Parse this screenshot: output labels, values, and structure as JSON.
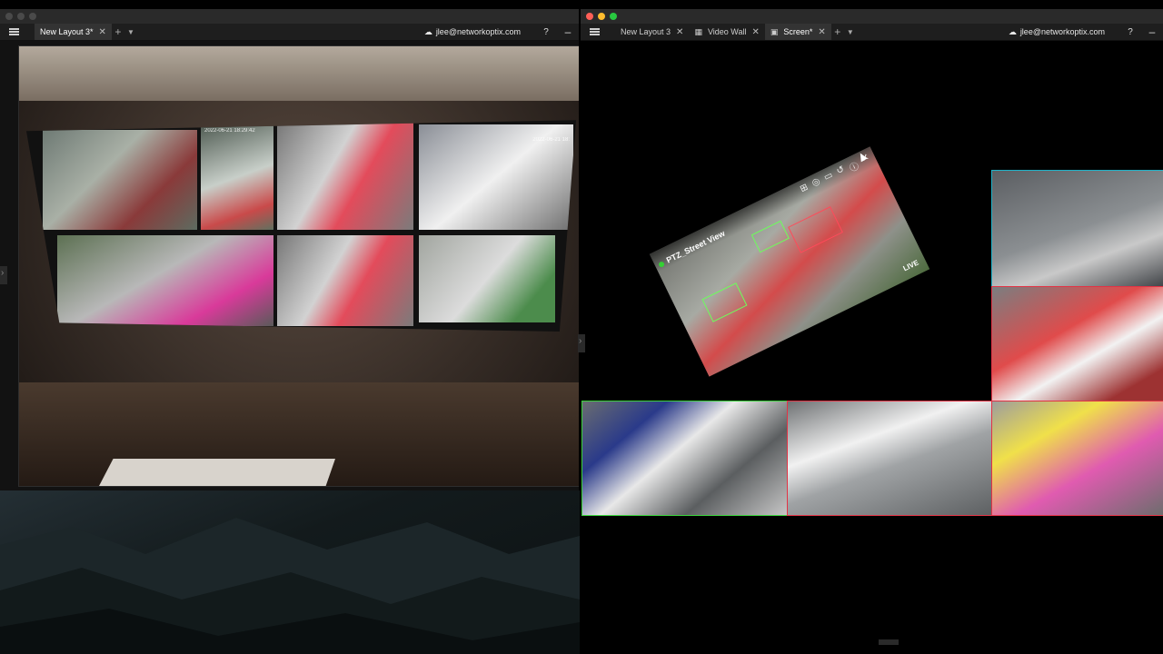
{
  "left_window": {
    "tabs": [
      {
        "label": "New Layout 3*",
        "active": true
      }
    ],
    "account": "jlee@networkoptix.com",
    "help_label": "?",
    "minimize_label": "–",
    "plus_label": "+",
    "timestamp_a": "2022-06-21 18:29:42",
    "timestamp_b": "2022-06-21 18:"
  },
  "right_window": {
    "tabs": [
      {
        "label": "New Layout 3",
        "active": false,
        "icon": ""
      },
      {
        "label": "Video Wall",
        "active": false,
        "icon": "video-wall-icon"
      },
      {
        "label": "Screen*",
        "active": true,
        "icon": "screen-icon"
      }
    ],
    "account": "jlee@networkoptix.com",
    "help_label": "?",
    "minimize_label": "–",
    "plus_label": "+",
    "ptz_camera": {
      "title": "PTZ_Street View",
      "status": "LIVE"
    }
  },
  "colors": {
    "accent_green": "#39d23a",
    "accent_red": "#e23345",
    "accent_cyan": "#1fb3c9"
  }
}
